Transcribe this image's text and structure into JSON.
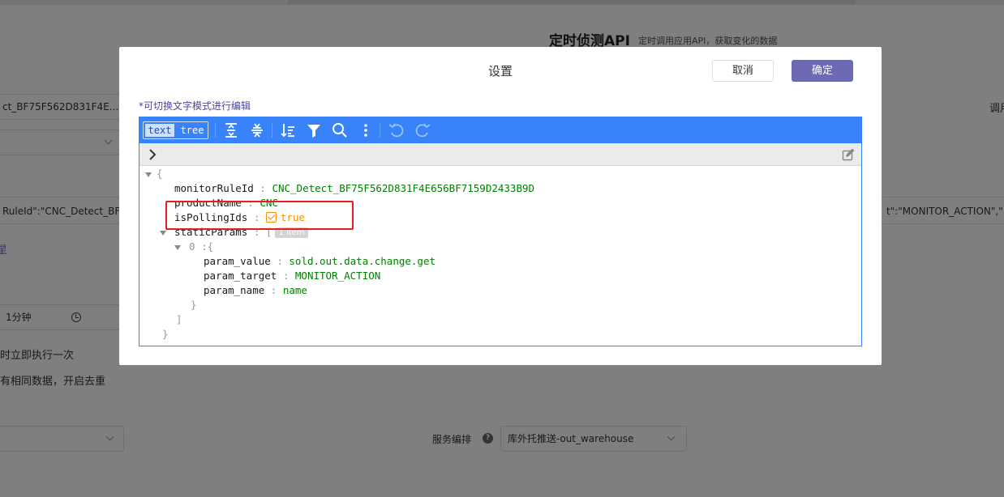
{
  "background": {
    "title": "定时侦测API",
    "subtitle": "定时调用应用API，获取变化的数据",
    "rule_id_field": "ct_BF75F562D831F4E...",
    "right_cut_label": "调用",
    "json_field_left": "RuleId\":\"CNC_Detect_BF",
    "json_field_right": "t\":\"MONITOR_ACTION\",\"",
    "link_fragment": "星",
    "interval_value": "1分钟",
    "run_once_label": "时立即执行一次",
    "dedupe_label": "有相同数据，开启去重",
    "service_label": "服务编排",
    "service_help": "?",
    "service_value": "库外托推送-out_warehouse"
  },
  "dialog": {
    "title": "设置",
    "cancel_label": "取消",
    "ok_label": "确定",
    "hint": "*可切换文字模式进行编辑",
    "modes": {
      "text": "text",
      "tree": "tree"
    },
    "toolbar_icons": [
      "expand-all-icon",
      "collapse-all-icon",
      "sort-icon",
      "filter-icon",
      "search-icon",
      "more-icon",
      "undo-icon",
      "redo-icon"
    ]
  },
  "json_tree": {
    "open_brace": "{",
    "close_brace": "}",
    "monitorRuleId": {
      "key": "monitorRuleId",
      "value": "CNC_Detect_BF75F562D831F4E656BF7159D2433B9D"
    },
    "productName": {
      "key": "productName",
      "value": "CNC"
    },
    "isPollingIds": {
      "key": "isPollingIds",
      "value": "true"
    },
    "staticParams": {
      "key": "staticParams",
      "open": "[",
      "close": "]",
      "badge": "1 item",
      "items": [
        {
          "index": "0",
          "open": "{",
          "close": "}",
          "param_value": {
            "key": "param_value",
            "value": "sold.out.data.change.get"
          },
          "param_target": {
            "key": "param_target",
            "value": "MONITOR_ACTION"
          },
          "param_name": {
            "key": "param_name",
            "value": "name"
          }
        }
      ]
    },
    "colon": ":"
  },
  "colors": {
    "menu_blue": "#3883fa",
    "primary_purple": "#6d6ab4",
    "highlight_red": "#e81d1d",
    "string_green": "#008000",
    "boolean_orange": "#ff8c00"
  }
}
